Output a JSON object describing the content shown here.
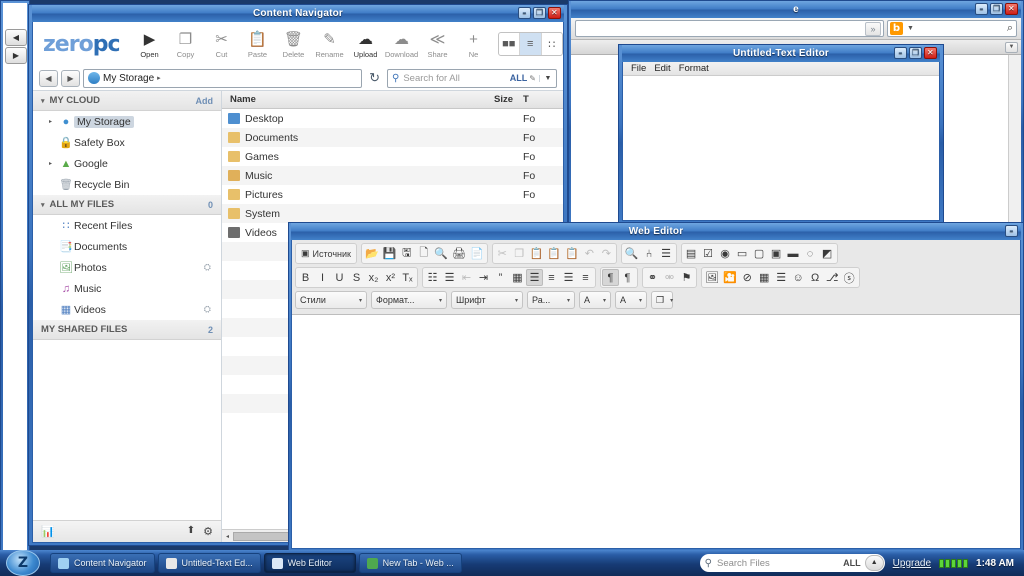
{
  "desktop": {
    "background_color": "#1a3a6b"
  },
  "background_browser": {
    "title": "e",
    "url_value": "",
    "search_value": "",
    "buttons": {
      "minimize": "–",
      "restore": "❐",
      "close": "✕"
    },
    "icons": {
      "chevrons": "»",
      "bing": "b",
      "dropdown": "▼",
      "search": "⌕",
      "mini_dropdown": "▼"
    }
  },
  "left_browser": {
    "back_label": "◀",
    "forward_label": "▶"
  },
  "content_navigator": {
    "title": "Content Navigator",
    "buttons": {
      "minimize": "–",
      "restore": "❐",
      "close": "✕"
    },
    "logo": {
      "light": "zero",
      "bold": "pc"
    },
    "toolbar": [
      {
        "label": "Open",
        "icon": "play-circle-icon",
        "enabled": true
      },
      {
        "label": "Copy",
        "icon": "copy-icon",
        "enabled": false
      },
      {
        "label": "Cut",
        "icon": "scissors-icon",
        "enabled": false
      },
      {
        "label": "Paste",
        "icon": "clipboard-icon",
        "enabled": false
      },
      {
        "label": "Delete",
        "icon": "trash-icon",
        "enabled": false
      },
      {
        "label": "Rename",
        "icon": "pencil-square-icon",
        "enabled": false
      },
      {
        "label": "Upload",
        "icon": "cloud-up-icon",
        "enabled": true
      },
      {
        "label": "Download",
        "icon": "cloud-down-icon",
        "enabled": false
      },
      {
        "label": "Share",
        "icon": "share-icon",
        "enabled": false
      },
      {
        "label": "Ne",
        "icon": "new-icon",
        "enabled": false
      }
    ],
    "view_modes": [
      {
        "name": "thumbnail-view",
        "glyph": "■■",
        "selected": false
      },
      {
        "name": "list-view",
        "glyph": "≡",
        "selected": true
      },
      {
        "name": "detail-view",
        "glyph": "∷",
        "selected": false
      }
    ],
    "path_bar": {
      "back": "◀",
      "forward": "▶",
      "current_path": "My Storage",
      "path_arrow": "▸",
      "refresh": "↻"
    },
    "search": {
      "placeholder": "Search for All",
      "scope": "ALL",
      "pen": "✎",
      "dropdown": "▼"
    },
    "sidebar": {
      "groups": [
        {
          "title": "MY CLOUD",
          "right": "Add",
          "items": [
            {
              "label": "My Storage",
              "icon": "cloud-icon",
              "twisty": "▸",
              "selected": true,
              "shared": ""
            },
            {
              "label": "Safety Box",
              "icon": "lock-icon",
              "twisty": "",
              "selected": false,
              "shared": ""
            },
            {
              "label": "Google",
              "icon": "google-drive-icon",
              "twisty": "▸",
              "selected": false,
              "shared": ""
            },
            {
              "label": "Recycle Bin",
              "icon": "recycle-bin-icon",
              "twisty": "",
              "selected": false,
              "shared": ""
            }
          ]
        },
        {
          "title": "ALL MY FILES",
          "right": "0",
          "items": [
            {
              "label": "Recent Files",
              "icon": "grid-icon",
              "twisty": "",
              "selected": false,
              "shared": ""
            },
            {
              "label": "Documents",
              "icon": "documents-icon",
              "twisty": "",
              "selected": false,
              "shared": ""
            },
            {
              "label": "Photos",
              "icon": "photos-icon",
              "twisty": "",
              "selected": false,
              "shared": "⛭"
            },
            {
              "label": "Music",
              "icon": "music-icon",
              "twisty": "",
              "selected": false,
              "shared": ""
            },
            {
              "label": "Videos",
              "icon": "videos-icon",
              "twisty": "",
              "selected": false,
              "shared": "⛭"
            }
          ]
        }
      ],
      "shared_group": {
        "title": "MY SHARED FILES",
        "right": "2"
      },
      "footer": {
        "left_icon": "monitor-chart-icon",
        "icons": [
          "upload-status-icon",
          "gear-icon"
        ]
      }
    },
    "file_list": {
      "columns": [
        "Name",
        "Size",
        "T"
      ],
      "rows": [
        {
          "name": "Desktop",
          "size": "",
          "type": "Fo",
          "icon": "desktop-folder-icon"
        },
        {
          "name": "Documents",
          "size": "",
          "type": "Fo",
          "icon": "documents-folder-icon"
        },
        {
          "name": "Games",
          "size": "",
          "type": "Fo",
          "icon": "folder-icon"
        },
        {
          "name": "Music",
          "size": "",
          "type": "Fo",
          "icon": "music-folder-icon"
        },
        {
          "name": "Pictures",
          "size": "",
          "type": "Fo",
          "icon": "pictures-folder-icon"
        },
        {
          "name": "System",
          "size": "",
          "type": "",
          "icon": "folder-icon"
        },
        {
          "name": "Videos",
          "size": "",
          "type": "",
          "icon": "videos-folder-icon"
        }
      ],
      "hscroll_left": "◂"
    }
  },
  "text_editor": {
    "title": "Untitled-Text Editor",
    "buttons": {
      "minimize": "–",
      "restore": "❐",
      "close": "✕"
    },
    "menu": [
      "File",
      "Edit",
      "Format"
    ],
    "content": ""
  },
  "web_editor": {
    "title": "Web Editor",
    "buttons": {
      "minimize": "–"
    },
    "toolbar_row1": [
      {
        "group": [
          {
            "name": "source-button",
            "label": "Источник",
            "icon": "source-code-icon"
          }
        ]
      },
      {
        "group": [
          {
            "name": "open-file-button",
            "glyph": "📂"
          },
          {
            "name": "save-button",
            "glyph": "💾"
          },
          {
            "name": "save-as-button",
            "glyph": "🖫"
          },
          {
            "name": "new-page-button",
            "glyph": "🗋"
          },
          {
            "name": "preview-button",
            "glyph": "🔍"
          },
          {
            "name": "print-button",
            "glyph": "🖨"
          },
          {
            "name": "templates-button",
            "glyph": "📄"
          }
        ]
      },
      {
        "group": [
          {
            "name": "cut-button",
            "glyph": "✂",
            "dim": true
          },
          {
            "name": "copy-button",
            "glyph": "❐",
            "dim": true
          },
          {
            "name": "paste-button",
            "glyph": "📋"
          },
          {
            "name": "paste-text-button",
            "glyph": "📋"
          },
          {
            "name": "paste-word-button",
            "glyph": "📋"
          },
          {
            "name": "undo-button",
            "glyph": "↶",
            "dim": true
          },
          {
            "name": "redo-button",
            "glyph": "↷",
            "dim": true
          }
        ]
      },
      {
        "group": [
          {
            "name": "find-button",
            "glyph": "🔍"
          },
          {
            "name": "replace-button",
            "glyph": "⑃"
          },
          {
            "name": "select-all-button",
            "glyph": "☰"
          }
        ]
      },
      {
        "group": [
          {
            "name": "form-button",
            "glyph": "▤"
          },
          {
            "name": "checkbox-button",
            "glyph": "☑"
          },
          {
            "name": "radio-button",
            "glyph": "◉"
          },
          {
            "name": "textfield-button",
            "glyph": "▭"
          },
          {
            "name": "textarea-button",
            "glyph": "▢"
          },
          {
            "name": "select-button",
            "glyph": "▣"
          },
          {
            "name": "button-button",
            "glyph": "▬"
          },
          {
            "name": "image-button-button",
            "glyph": "◌"
          },
          {
            "name": "hidden-field-button",
            "glyph": "◩"
          }
        ]
      }
    ],
    "toolbar_row2": [
      {
        "group": [
          {
            "name": "bold-button",
            "glyph": "B"
          },
          {
            "name": "italic-button",
            "glyph": "I"
          },
          {
            "name": "underline-button",
            "glyph": "U"
          },
          {
            "name": "strike-button",
            "glyph": "S"
          },
          {
            "name": "subscript-button",
            "glyph": "x₂"
          },
          {
            "name": "superscript-button",
            "glyph": "x²"
          },
          {
            "name": "remove-format-button",
            "glyph": "Tₓ"
          }
        ]
      },
      {
        "group": [
          {
            "name": "numbered-list-button",
            "glyph": "☷"
          },
          {
            "name": "bulleted-list-button",
            "glyph": "☰"
          },
          {
            "name": "outdent-button",
            "glyph": "⇤",
            "dim": true
          },
          {
            "name": "indent-button",
            "glyph": "⇥"
          },
          {
            "name": "blockquote-button",
            "glyph": "”"
          },
          {
            "name": "div-button",
            "glyph": "▦"
          },
          {
            "name": "align-left-button",
            "glyph": "☰",
            "on": true
          },
          {
            "name": "align-center-button",
            "glyph": "≡"
          },
          {
            "name": "align-right-button",
            "glyph": "☰"
          },
          {
            "name": "align-justify-button",
            "glyph": "≡"
          }
        ]
      },
      {
        "group": [
          {
            "name": "ltr-button",
            "glyph": "¶",
            "on": true
          },
          {
            "name": "rtl-button",
            "glyph": "¶"
          }
        ]
      },
      {
        "group": [
          {
            "name": "link-button",
            "glyph": "⚭"
          },
          {
            "name": "unlink-button",
            "glyph": "⚮",
            "dim": true
          },
          {
            "name": "anchor-button",
            "glyph": "⚑"
          }
        ]
      },
      {
        "group": [
          {
            "name": "image-button",
            "glyph": "🖼"
          },
          {
            "name": "flash-button",
            "glyph": "🎦"
          },
          {
            "name": "iframe-button",
            "glyph": "⊘"
          },
          {
            "name": "table-button",
            "glyph": "▦"
          },
          {
            "name": "hr-button",
            "glyph": "☰"
          },
          {
            "name": "smiley-button",
            "glyph": "☺"
          },
          {
            "name": "special-char-button",
            "glyph": "Ω"
          },
          {
            "name": "page-break-button",
            "glyph": "⎇"
          },
          {
            "name": "globe-button",
            "glyph": "ⓢ"
          }
        ]
      }
    ],
    "toolbar_row3": [
      {
        "name": "styles-combo",
        "label": "Стили",
        "width": 72
      },
      {
        "name": "format-combo",
        "label": "Формат...",
        "width": 76
      },
      {
        "name": "font-combo",
        "label": "Шрифт",
        "width": 72
      },
      {
        "name": "size-combo",
        "label": "Ра...",
        "width": 48
      },
      {
        "name": "text-color-button",
        "label": "A",
        "width": 32
      },
      {
        "name": "bg-color-button",
        "label": "A",
        "width": 32
      },
      {
        "name": "maximize-editor-button",
        "label": "❐",
        "width": 22
      }
    ],
    "content": ""
  },
  "taskbar": {
    "start_label": "Z",
    "tasks": [
      {
        "label": "Content Navigator",
        "icon_color": "#9fd0f2",
        "active": false
      },
      {
        "label": "Untitled-Text Ed...",
        "icon_color": "#e8e8e8",
        "active": false
      },
      {
        "label": "Web Editor",
        "icon_color": "#dce8f5",
        "active": true
      },
      {
        "label": "New Tab - Web ...",
        "icon_color": "#4fa84f",
        "active": false
      }
    ],
    "search": {
      "placeholder": "Search Files",
      "scope": "ALL",
      "toggle": "▲"
    },
    "upgrade_label": "Upgrade",
    "signal_bars": 5,
    "clock": "1:48 AM"
  }
}
